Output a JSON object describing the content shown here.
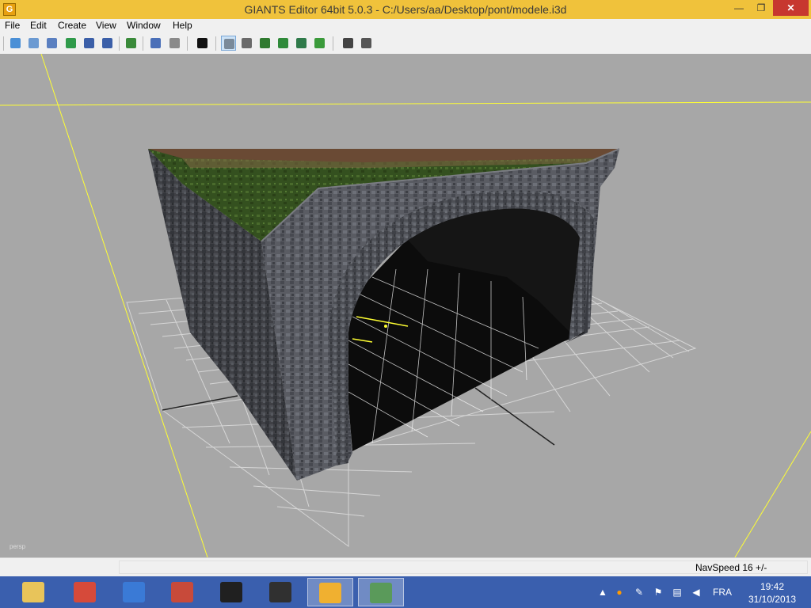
{
  "window": {
    "icon_letter": "G",
    "title": "GIANTS Editor 64bit 5.0.3 - C:/Users/aa/Desktop/pont/modele.i3d",
    "min_glyph": "—",
    "max_glyph": "❐",
    "close_glyph": "✕"
  },
  "menu": [
    "File",
    "Edit",
    "Create",
    "View",
    "Window",
    "Help"
  ],
  "toolbar": {
    "buttons": [
      {
        "name": "new-scene-icon",
        "color": "#4a8fd6"
      },
      {
        "name": "open-folder-icon",
        "color": "#6b9ad2"
      },
      {
        "name": "document-icon",
        "color": "#5a7fc0"
      },
      {
        "name": "refresh-icon",
        "color": "#2f9a4a"
      },
      {
        "name": "save-icon",
        "color": "#3b5fa8"
      },
      {
        "name": "save-as-icon",
        "color": "#3b5fa8"
      },
      {
        "name": "import-icon",
        "color": "#3a8a3a"
      },
      {
        "name": "undo-icon",
        "color": "#4a6fb8"
      },
      {
        "name": "redo-icon",
        "color": "#8a8a8a"
      },
      {
        "name": "play-icon",
        "color": "#111111"
      },
      {
        "name": "home-icon",
        "color": "#7a8a9a"
      },
      {
        "name": "magnet-icon",
        "color": "#6a6a6a"
      },
      {
        "name": "terrain-icon",
        "color": "#2f7a2f"
      },
      {
        "name": "terrain-paint-icon",
        "color": "#2f8a3a"
      },
      {
        "name": "foliage-icon",
        "color": "#2f7a4a"
      },
      {
        "name": "grass-icon",
        "color": "#3a9a3a"
      },
      {
        "name": "particle-icon",
        "color": "#444444"
      },
      {
        "name": "settings-gear-icon",
        "color": "#555555"
      }
    ]
  },
  "viewport": {
    "camera_label": "persp",
    "grid_color": "#d6d6d6",
    "axis_color": "#ffff33"
  },
  "status": {
    "navspeed": "NavSpeed 16 +/-"
  },
  "taskbar": {
    "apps": [
      {
        "name": "file-explorer-icon",
        "color": "#e8c45a"
      },
      {
        "name": "chrome-icon",
        "color": "#d64a3a"
      },
      {
        "name": "app-blue-icon",
        "color": "#3a7ad6"
      },
      {
        "name": "paint-brush-icon",
        "color": "#c84a3a"
      },
      {
        "name": "monitor-99-icon",
        "color": "#202020"
      },
      {
        "name": "shield-leaf-icon",
        "color": "#303030"
      },
      {
        "name": "giants-editor-icon",
        "color": "#f0b030"
      },
      {
        "name": "text-editor-icon",
        "color": "#5a9a5a"
      }
    ],
    "tray": [
      "▲",
      "●",
      "✎",
      "⚑",
      "▤",
      "◀"
    ],
    "lang": "FRA",
    "time": "19:42",
    "date": "31/10/2013"
  }
}
